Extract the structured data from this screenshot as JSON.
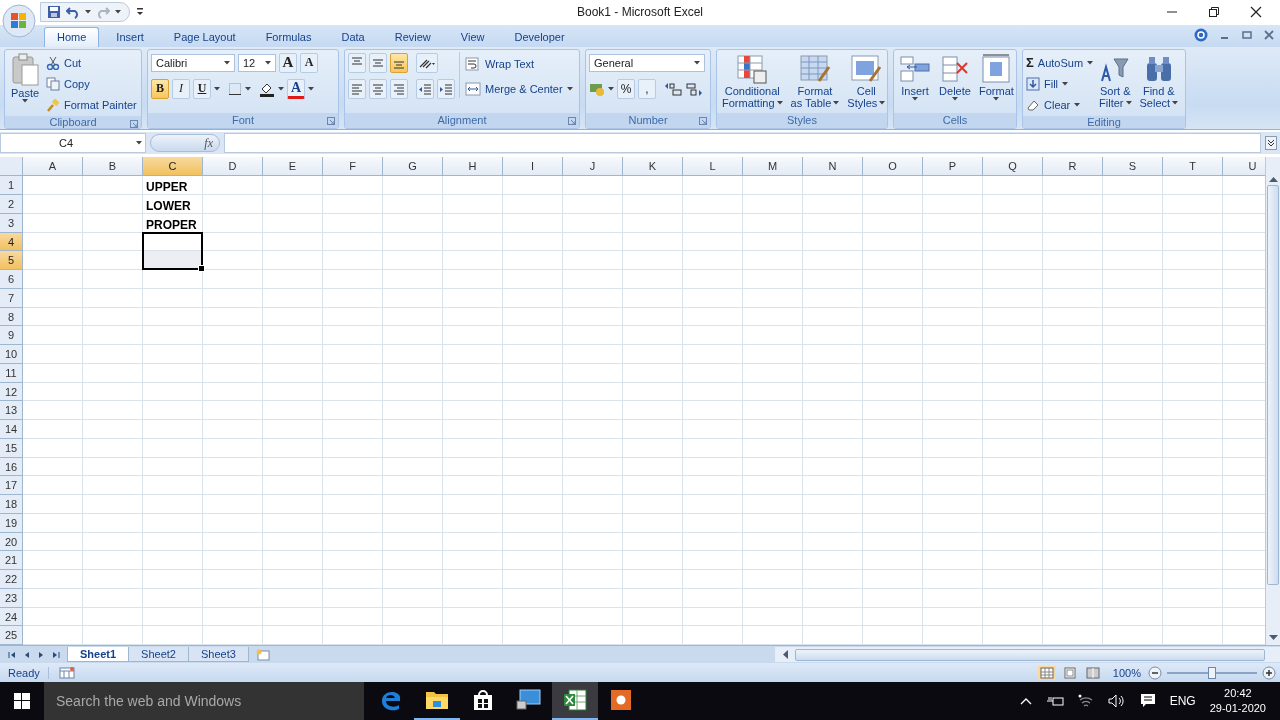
{
  "window": {
    "title": "Book1 - Microsoft Excel"
  },
  "tabs": [
    {
      "label": "Home",
      "selected": true
    },
    {
      "label": "Insert",
      "selected": false
    },
    {
      "label": "Page Layout",
      "selected": false
    },
    {
      "label": "Formulas",
      "selected": false
    },
    {
      "label": "Data",
      "selected": false
    },
    {
      "label": "Review",
      "selected": false
    },
    {
      "label": "View",
      "selected": false
    },
    {
      "label": "Developer",
      "selected": false
    }
  ],
  "ribbon": {
    "clipboard": {
      "label": "Clipboard",
      "paste": "Paste",
      "cut": "Cut",
      "copy": "Copy",
      "format_painter": "Format Painter"
    },
    "font": {
      "label": "Font",
      "font_name": "Calibri",
      "font_size": "12",
      "grow": "A",
      "shrink": "A",
      "bold": {
        "label": "B",
        "selected": true
      },
      "italic": {
        "label": "I",
        "selected": false
      },
      "underline": {
        "label": "U",
        "selected": false
      },
      "font_color": "A"
    },
    "alignment": {
      "label": "Alignment",
      "vertical": [
        {
          "selected": false
        },
        {
          "selected": false
        },
        {
          "selected": true
        }
      ],
      "wrap_text": "Wrap Text",
      "merge_center": "Merge & Center"
    },
    "number": {
      "label": "Number",
      "format": "General",
      "percent": "%",
      "comma": ","
    },
    "styles": {
      "label": "Styles",
      "buttons": [
        {
          "lines": [
            "Conditional",
            "Formatting"
          ]
        },
        {
          "lines": [
            "Format",
            "as Table"
          ]
        },
        {
          "lines": [
            "Cell",
            "Styles"
          ]
        }
      ]
    },
    "cells": {
      "label": "Cells",
      "buttons": [
        {
          "lines": [
            "Insert"
          ]
        },
        {
          "lines": [
            "Delete"
          ]
        },
        {
          "lines": [
            "Format"
          ]
        }
      ]
    },
    "editing": {
      "label": "Editing",
      "sigma": "Σ",
      "autosum": "AutoSum",
      "fill": "Fill",
      "clear": "Clear",
      "buttons": [
        {
          "lines": [
            "Sort &",
            "Filter"
          ]
        },
        {
          "lines": [
            "Find &",
            "Select"
          ]
        }
      ]
    }
  },
  "formula_bar": {
    "name_box": "C4",
    "fx": "fx"
  },
  "sheet": {
    "columns": [
      {
        "label": "A",
        "selected": false
      },
      {
        "label": "B",
        "selected": false
      },
      {
        "label": "C",
        "selected": true
      },
      {
        "label": "D",
        "selected": false
      },
      {
        "label": "E",
        "selected": false
      },
      {
        "label": "F",
        "selected": false
      },
      {
        "label": "G",
        "selected": false
      },
      {
        "label": "H",
        "selected": false
      },
      {
        "label": "I",
        "selected": false
      },
      {
        "label": "J",
        "selected": false
      },
      {
        "label": "K",
        "selected": false
      },
      {
        "label": "L",
        "selected": false
      },
      {
        "label": "M",
        "selected": false
      },
      {
        "label": "N",
        "selected": false
      },
      {
        "label": "O",
        "selected": false
      },
      {
        "label": "P",
        "selected": false
      },
      {
        "label": "Q",
        "selected": false
      },
      {
        "label": "R",
        "selected": false
      },
      {
        "label": "S",
        "selected": false
      },
      {
        "label": "T",
        "selected": false
      },
      {
        "label": "U",
        "selected": false
      }
    ],
    "rows": [
      {
        "label": "1",
        "selected": false,
        "column_c": "UPPER"
      },
      {
        "label": "2",
        "selected": false,
        "column_c": "LOWER"
      },
      {
        "label": "3",
        "selected": false,
        "column_c": "PROPER"
      },
      {
        "label": "4",
        "selected": true
      },
      {
        "label": "5",
        "selected": true
      },
      {
        "label": "6",
        "selected": false
      },
      {
        "label": "7",
        "selected": false
      },
      {
        "label": "8",
        "selected": false
      },
      {
        "label": "9",
        "selected": false
      },
      {
        "label": "10",
        "selected": false
      },
      {
        "label": "11",
        "selected": false
      },
      {
        "label": "12",
        "selected": false
      },
      {
        "label": "13",
        "selected": false
      },
      {
        "label": "14",
        "selected": false
      },
      {
        "label": "15",
        "selected": false
      },
      {
        "label": "16",
        "selected": false
      },
      {
        "label": "17",
        "selected": false
      },
      {
        "label": "18",
        "selected": false
      },
      {
        "label": "19",
        "selected": false
      },
      {
        "label": "20",
        "selected": false
      },
      {
        "label": "21",
        "selected": false
      },
      {
        "label": "22",
        "selected": false
      },
      {
        "label": "23",
        "selected": false
      },
      {
        "label": "24",
        "selected": false
      },
      {
        "label": "25",
        "selected": false
      }
    ]
  },
  "sheet_tabs": [
    {
      "label": "Sheet1",
      "selected": true
    },
    {
      "label": "Sheet2",
      "selected": false
    },
    {
      "label": "Sheet3",
      "selected": false
    }
  ],
  "status_bar": {
    "status": "Ready",
    "zoom": "100%",
    "zoom_slider": {
      "level": 0.5
    }
  },
  "taskbar": {
    "search_placeholder": "Search the web and Windows",
    "apps": [
      {
        "running": false,
        "selected": false
      },
      {
        "running": true,
        "selected": false
      },
      {
        "running": false,
        "selected": false
      },
      {
        "running": false,
        "selected": false
      },
      {
        "running": true,
        "selected": true
      },
      {
        "running": false,
        "selected": false
      }
    ],
    "language": "ENG",
    "time": "20:42",
    "date": "29-01-2020"
  }
}
